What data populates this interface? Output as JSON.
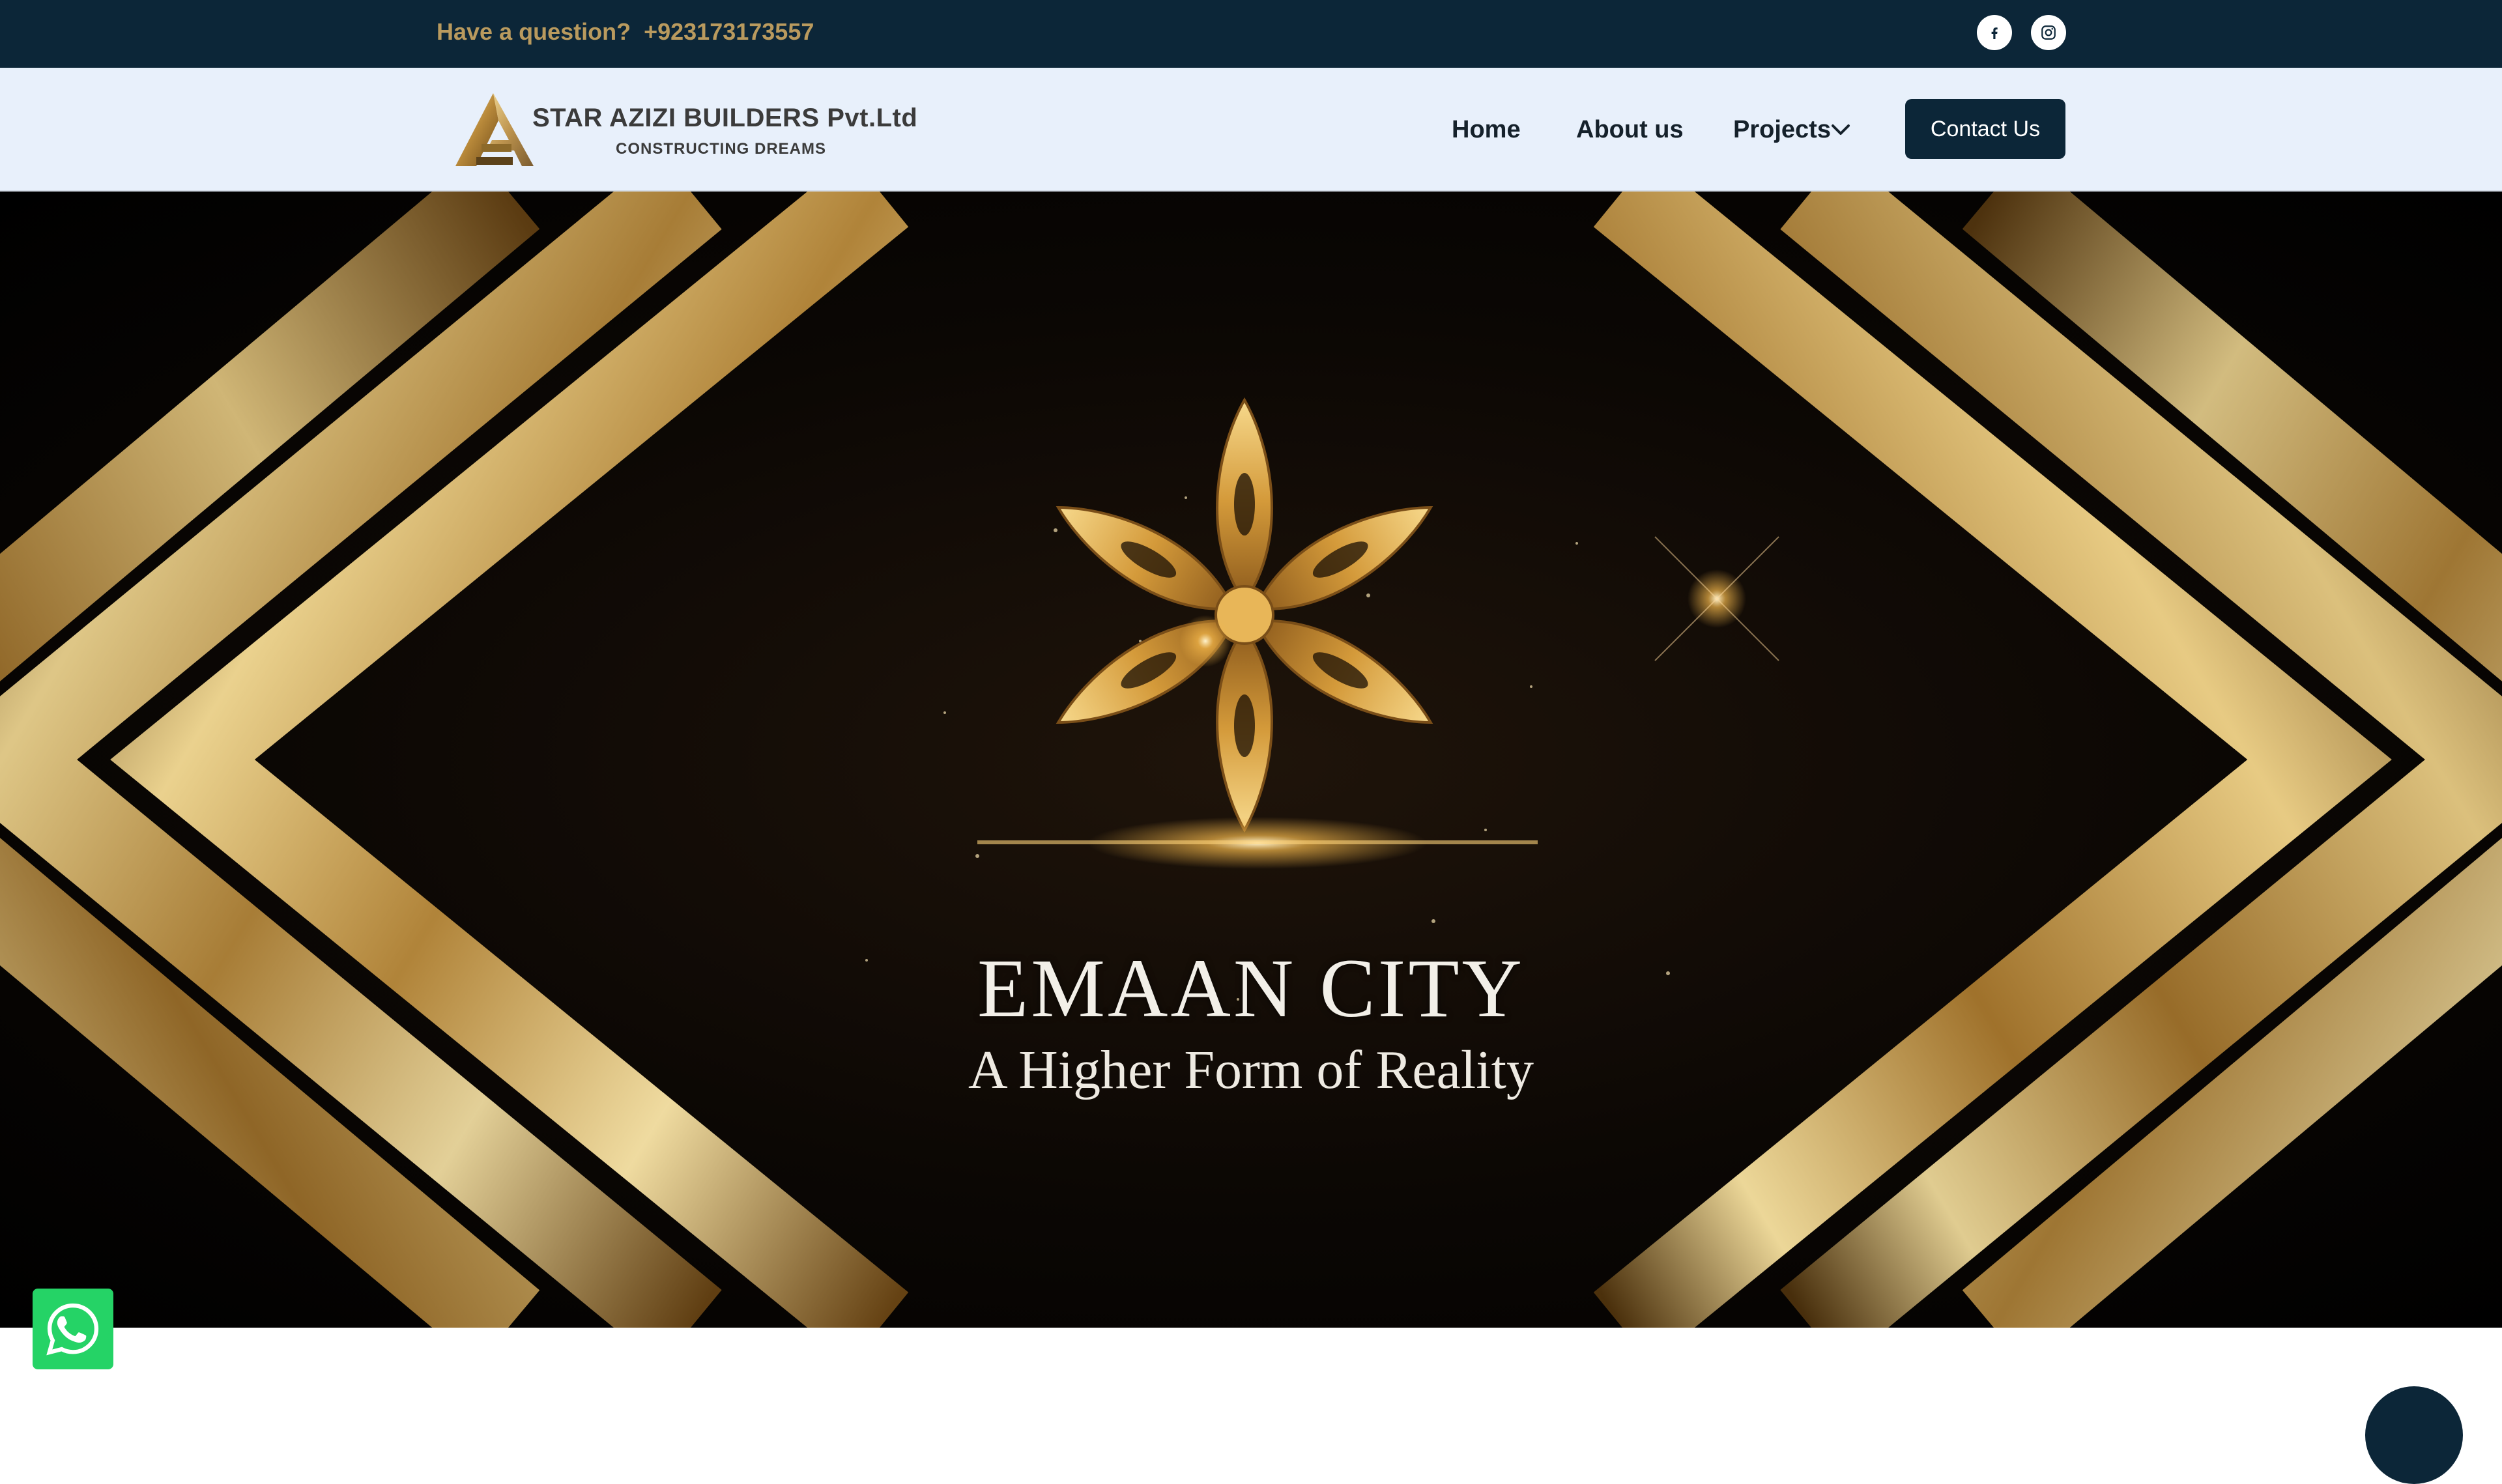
{
  "topbar": {
    "question": "Have a question?",
    "phone": "+923173173557",
    "social": [
      {
        "name": "facebook",
        "icon": "facebook-icon"
      },
      {
        "name": "instagram",
        "icon": "instagram-icon"
      }
    ]
  },
  "header": {
    "logo": {
      "name": "STAR AZIZI BUILDERS Pvt.Ltd",
      "tagline": "CONSTRUCTING DREAMS"
    },
    "nav": {
      "home": "Home",
      "about": "About us",
      "projects": "Projects",
      "contact": "Contact Us"
    }
  },
  "hero": {
    "title": "EMAAN CITY",
    "subtitle": "A Higher Form of Reality"
  },
  "colors": {
    "topbar_bg": "#0c2638",
    "accent_gold": "#b99a5e",
    "header_bg": "#e8f0fb",
    "button_bg": "#0c2638",
    "whatsapp_green": "#25d366"
  },
  "icons": [
    "facebook-icon",
    "instagram-icon",
    "chevron-down-icon",
    "whatsapp-icon",
    "star-emblem"
  ]
}
